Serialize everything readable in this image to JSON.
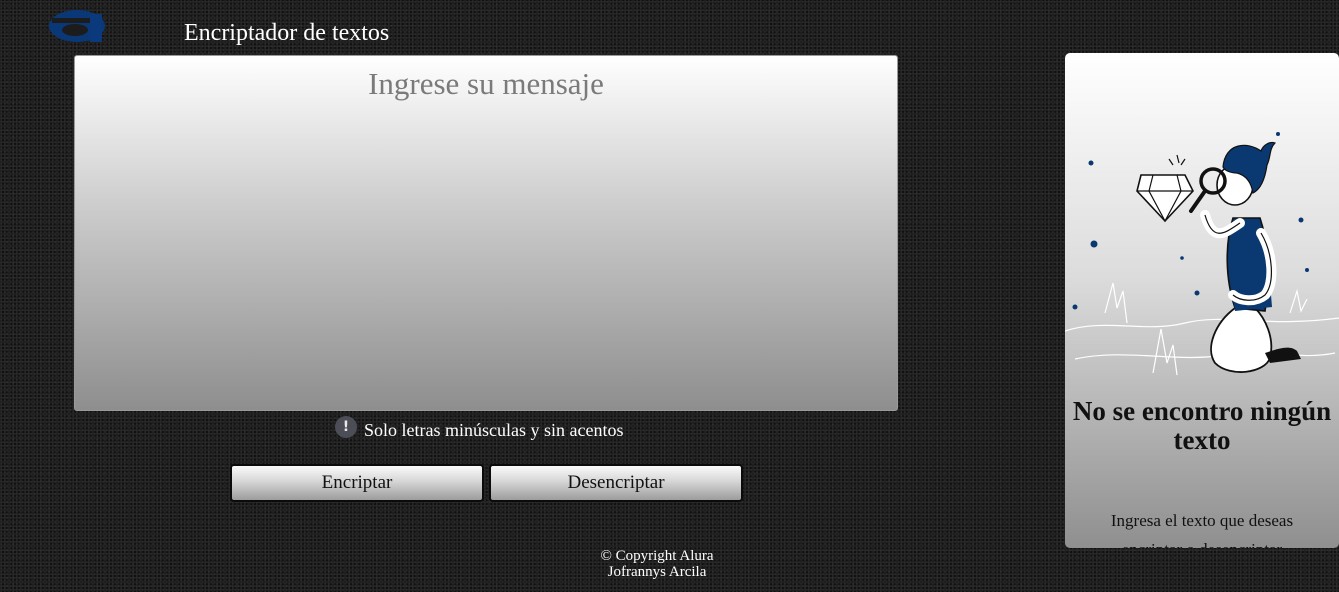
{
  "header": {
    "logo_letter": "a",
    "title": "Encriptador de textos"
  },
  "input": {
    "placeholder": "Ingrese su mensaje",
    "value": ""
  },
  "hint": {
    "icon_glyph": "!",
    "text": "Solo letras minúsculas y sin acentos"
  },
  "buttons": {
    "encrypt_label": "Encriptar",
    "decrypt_label": "Desencriptar"
  },
  "footer": {
    "copyright": "© Copyright Alura",
    "author": "Jofrannys Arcila"
  },
  "result_panel": {
    "heading": "No se encontro ningún texto",
    "message": "Ingresa el texto que deseas encriptar o desencriptar"
  },
  "colors": {
    "logo_blue": "#0a3a7c",
    "accent_blue": "#0a3871",
    "hint_icon_bg": "#4b4e57"
  },
  "icons": {
    "logo": "alura-logo-icon",
    "hint": "exclamation-circle-icon",
    "illustration": "person-magnifier-diamond-illustration"
  }
}
